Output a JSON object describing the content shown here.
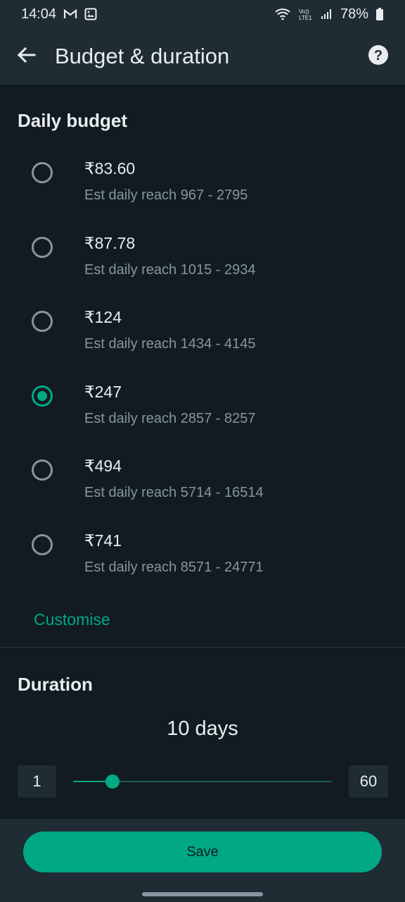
{
  "status_bar": {
    "time": "14:04",
    "battery": "78%",
    "left_icons": [
      "gmail-icon",
      "gallery-icon"
    ],
    "right_icons": [
      "wifi-icon",
      "volte-icon",
      "signal-icon",
      "battery-icon"
    ]
  },
  "app_bar": {
    "title": "Budget & duration",
    "back_icon": "arrow-left-icon",
    "help_icon": "help-icon"
  },
  "daily_budget": {
    "title": "Daily budget",
    "options": [
      {
        "amount": "₹83.60",
        "reach": "Est daily reach 967 - 2795",
        "selected": false
      },
      {
        "amount": "₹87.78",
        "reach": "Est daily reach 1015 - 2934",
        "selected": false
      },
      {
        "amount": "₹124",
        "reach": "Est daily reach 1434 - 4145",
        "selected": false
      },
      {
        "amount": "₹247",
        "reach": "Est daily reach 2857 - 8257",
        "selected": true
      },
      {
        "amount": "₹494",
        "reach": "Est daily reach 5714 - 16514",
        "selected": false
      },
      {
        "amount": "₹741",
        "reach": "Est daily reach 8571 - 24771",
        "selected": false
      }
    ],
    "customise_label": "Customise"
  },
  "duration": {
    "title": "Duration",
    "value_label": "10 days",
    "min": "1",
    "max": "60",
    "value": 10
  },
  "footer": {
    "save_label": "Save"
  },
  "colors": {
    "accent": "#00a884",
    "background": "#111b21",
    "surface": "#1f2c34",
    "secondary_text": "#8696a0"
  }
}
